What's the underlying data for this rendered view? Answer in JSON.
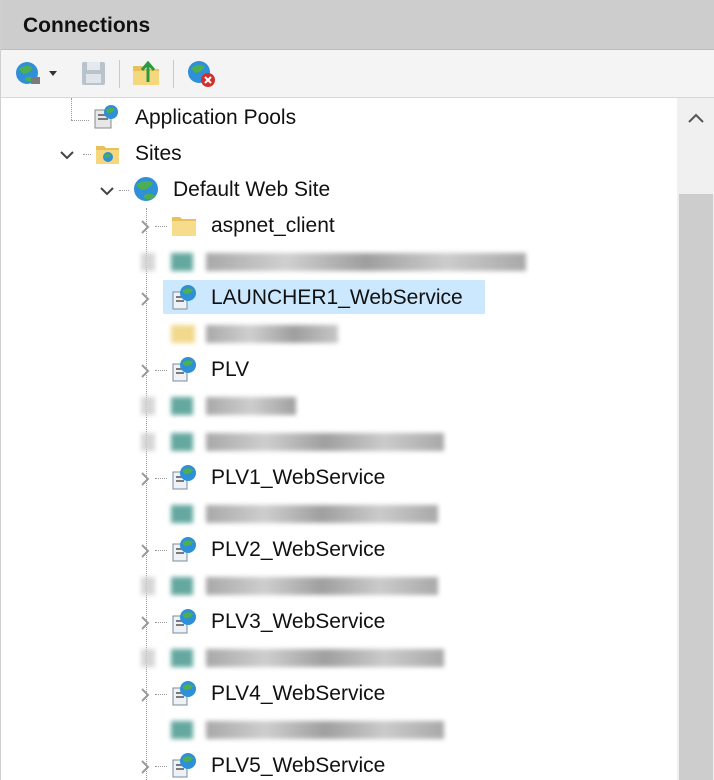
{
  "panel": {
    "title": "Connections"
  },
  "toolbar": {
    "buttons": [
      {
        "name": "connect-icon"
      },
      {
        "name": "save-icon"
      },
      {
        "name": "up-folder-icon"
      },
      {
        "name": "disconnect-icon"
      }
    ]
  },
  "tree": {
    "items": [
      {
        "label": "Application Pools",
        "icon": "app-pools-icon",
        "blurred": false
      },
      {
        "label": "Sites",
        "icon": "sites-icon",
        "blurred": false
      },
      {
        "label": "Default Web Site",
        "icon": "globe-icon",
        "blurred": false
      },
      {
        "label": "aspnet_client",
        "icon": "folder-icon",
        "blurred": false
      },
      {
        "label": "",
        "icon": "webapp-icon",
        "blurred": true
      },
      {
        "label": "LAUNCHER1_WebService",
        "icon": "webapp-icon",
        "blurred": false,
        "selected": true
      },
      {
        "label": "",
        "icon": "folder-icon",
        "blurred": true
      },
      {
        "label": "PLV",
        "icon": "webapp-icon",
        "blurred": false
      },
      {
        "label": "",
        "icon": "webapp-icon",
        "blurred": true
      },
      {
        "label": "",
        "icon": "webapp-icon",
        "blurred": true
      },
      {
        "label": "PLV1_WebService",
        "icon": "webapp-icon",
        "blurred": false
      },
      {
        "label": "",
        "icon": "webapp-icon",
        "blurred": true
      },
      {
        "label": "PLV2_WebService",
        "icon": "webapp-icon",
        "blurred": false
      },
      {
        "label": "",
        "icon": "webapp-icon",
        "blurred": true
      },
      {
        "label": "PLV3_WebService",
        "icon": "webapp-icon",
        "blurred": false
      },
      {
        "label": "",
        "icon": "webapp-icon",
        "blurred": true
      },
      {
        "label": "PLV4_WebService",
        "icon": "webapp-icon",
        "blurred": false
      },
      {
        "label": "",
        "icon": "webapp-icon",
        "blurred": true
      },
      {
        "label": "PLV5_WebService",
        "icon": "webapp-icon",
        "blurred": false
      }
    ]
  },
  "colors": {
    "header_bg": "#cdcdcd",
    "selection_bg": "#cce8ff",
    "scroll_thumb": "#cdcdcd"
  }
}
